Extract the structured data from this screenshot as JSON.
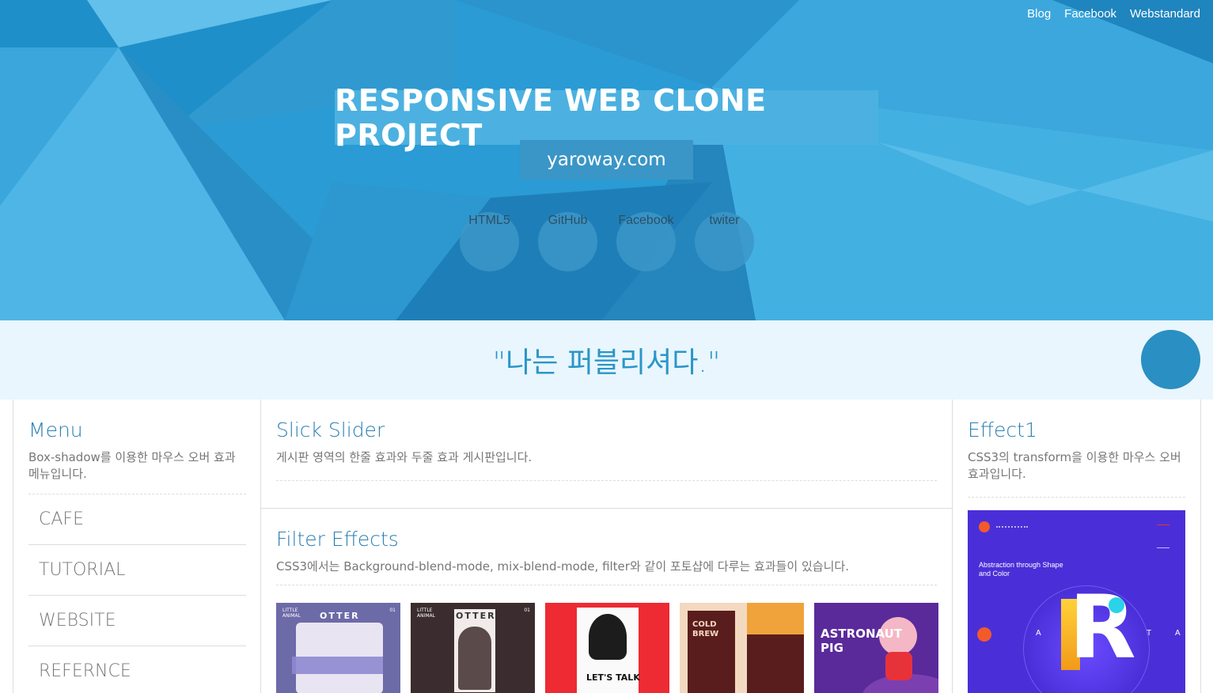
{
  "top_links": [
    "Blog",
    "Facebook",
    "Webstandard"
  ],
  "header": {
    "title": "RESPONSIVE WEB CLONE PROJECT",
    "subtitle": "yaroway.com",
    "circle_nav": [
      "HTML5",
      "GitHub",
      "Facebook",
      "twiter"
    ]
  },
  "quote": "\"나는 퍼블리셔다.\"",
  "menu": {
    "title": "Menu",
    "desc": "Box-shadow를 이용한 마우스 오버 효과 메뉴입니다.",
    "items": [
      "CAFE",
      "TUTORIAL",
      "WEBSITE",
      "REFERNCE"
    ]
  },
  "slick": {
    "title": "Slick Slider",
    "desc": "게시판 영역의 한줄 효과와 두줄 효과 게시판입니다."
  },
  "filter": {
    "title": "Filter Effects",
    "desc": "CSS3에서는 Background-blend-mode, mix-blend-mode, filter와 같이 포토샵에 다루는 효과들이 있습니다.",
    "thumbs": [
      {
        "top": "LITTLE ANIMAL",
        "word": "OTTER",
        "num": "01"
      },
      {
        "top": "LITTLE ANIMAL",
        "word": "OTTER",
        "num": "01"
      },
      {
        "top": "",
        "word": "LET'S TALK",
        "num": ""
      },
      {
        "top": "",
        "word": "COLD BREW",
        "num": ""
      },
      {
        "top": "",
        "word": "ASTRONAUT PIG",
        "num": ""
      }
    ]
  },
  "effect": {
    "title": "Effect1",
    "desc": "CSS3의 transform을 이용한 마우스 오버효과입니다.",
    "img_heading": "Abstraction through Shape and Color",
    "letter": "R",
    "side_left": "A",
    "side_mid": "T",
    "side_right": "A"
  },
  "colors": {
    "header_blue": "#2a9bd4",
    "title_box": "#4cb1e0",
    "quote_bg": "#e9f6fd",
    "accent": "#2a7fb0"
  }
}
